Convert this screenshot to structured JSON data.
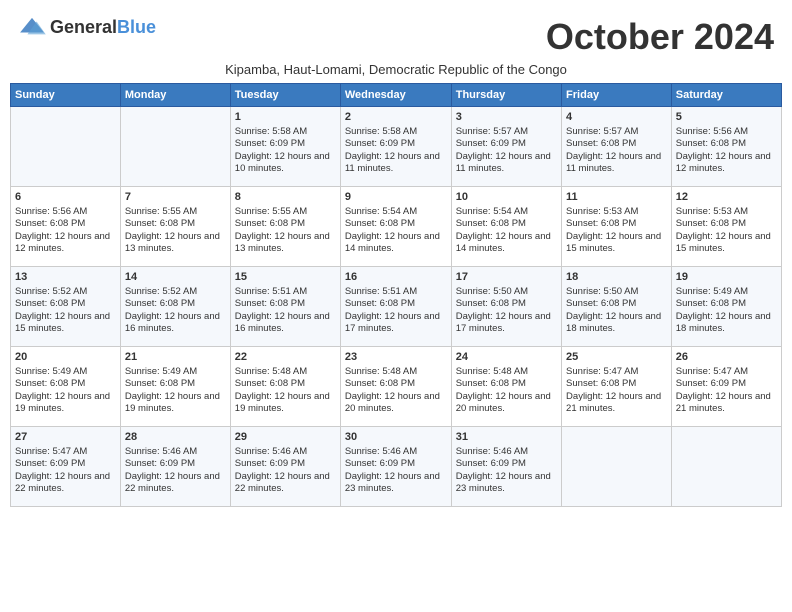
{
  "header": {
    "logo_general": "General",
    "logo_blue": "Blue",
    "month_title": "October 2024",
    "subtitle": "Kipamba, Haut-Lomami, Democratic Republic of the Congo"
  },
  "days_of_week": [
    "Sunday",
    "Monday",
    "Tuesday",
    "Wednesday",
    "Thursday",
    "Friday",
    "Saturday"
  ],
  "weeks": [
    [
      {
        "day": "",
        "sunrise": "",
        "sunset": "",
        "daylight": ""
      },
      {
        "day": "",
        "sunrise": "",
        "sunset": "",
        "daylight": ""
      },
      {
        "day": "1",
        "sunrise": "Sunrise: 5:58 AM",
        "sunset": "Sunset: 6:09 PM",
        "daylight": "Daylight: 12 hours and 10 minutes."
      },
      {
        "day": "2",
        "sunrise": "Sunrise: 5:58 AM",
        "sunset": "Sunset: 6:09 PM",
        "daylight": "Daylight: 12 hours and 11 minutes."
      },
      {
        "day": "3",
        "sunrise": "Sunrise: 5:57 AM",
        "sunset": "Sunset: 6:09 PM",
        "daylight": "Daylight: 12 hours and 11 minutes."
      },
      {
        "day": "4",
        "sunrise": "Sunrise: 5:57 AM",
        "sunset": "Sunset: 6:08 PM",
        "daylight": "Daylight: 12 hours and 11 minutes."
      },
      {
        "day": "5",
        "sunrise": "Sunrise: 5:56 AM",
        "sunset": "Sunset: 6:08 PM",
        "daylight": "Daylight: 12 hours and 12 minutes."
      }
    ],
    [
      {
        "day": "6",
        "sunrise": "Sunrise: 5:56 AM",
        "sunset": "Sunset: 6:08 PM",
        "daylight": "Daylight: 12 hours and 12 minutes."
      },
      {
        "day": "7",
        "sunrise": "Sunrise: 5:55 AM",
        "sunset": "Sunset: 6:08 PM",
        "daylight": "Daylight: 12 hours and 13 minutes."
      },
      {
        "day": "8",
        "sunrise": "Sunrise: 5:55 AM",
        "sunset": "Sunset: 6:08 PM",
        "daylight": "Daylight: 12 hours and 13 minutes."
      },
      {
        "day": "9",
        "sunrise": "Sunrise: 5:54 AM",
        "sunset": "Sunset: 6:08 PM",
        "daylight": "Daylight: 12 hours and 14 minutes."
      },
      {
        "day": "10",
        "sunrise": "Sunrise: 5:54 AM",
        "sunset": "Sunset: 6:08 PM",
        "daylight": "Daylight: 12 hours and 14 minutes."
      },
      {
        "day": "11",
        "sunrise": "Sunrise: 5:53 AM",
        "sunset": "Sunset: 6:08 PM",
        "daylight": "Daylight: 12 hours and 15 minutes."
      },
      {
        "day": "12",
        "sunrise": "Sunrise: 5:53 AM",
        "sunset": "Sunset: 6:08 PM",
        "daylight": "Daylight: 12 hours and 15 minutes."
      }
    ],
    [
      {
        "day": "13",
        "sunrise": "Sunrise: 5:52 AM",
        "sunset": "Sunset: 6:08 PM",
        "daylight": "Daylight: 12 hours and 15 minutes."
      },
      {
        "day": "14",
        "sunrise": "Sunrise: 5:52 AM",
        "sunset": "Sunset: 6:08 PM",
        "daylight": "Daylight: 12 hours and 16 minutes."
      },
      {
        "day": "15",
        "sunrise": "Sunrise: 5:51 AM",
        "sunset": "Sunset: 6:08 PM",
        "daylight": "Daylight: 12 hours and 16 minutes."
      },
      {
        "day": "16",
        "sunrise": "Sunrise: 5:51 AM",
        "sunset": "Sunset: 6:08 PM",
        "daylight": "Daylight: 12 hours and 17 minutes."
      },
      {
        "day": "17",
        "sunrise": "Sunrise: 5:50 AM",
        "sunset": "Sunset: 6:08 PM",
        "daylight": "Daylight: 12 hours and 17 minutes."
      },
      {
        "day": "18",
        "sunrise": "Sunrise: 5:50 AM",
        "sunset": "Sunset: 6:08 PM",
        "daylight": "Daylight: 12 hours and 18 minutes."
      },
      {
        "day": "19",
        "sunrise": "Sunrise: 5:49 AM",
        "sunset": "Sunset: 6:08 PM",
        "daylight": "Daylight: 12 hours and 18 minutes."
      }
    ],
    [
      {
        "day": "20",
        "sunrise": "Sunrise: 5:49 AM",
        "sunset": "Sunset: 6:08 PM",
        "daylight": "Daylight: 12 hours and 19 minutes."
      },
      {
        "day": "21",
        "sunrise": "Sunrise: 5:49 AM",
        "sunset": "Sunset: 6:08 PM",
        "daylight": "Daylight: 12 hours and 19 minutes."
      },
      {
        "day": "22",
        "sunrise": "Sunrise: 5:48 AM",
        "sunset": "Sunset: 6:08 PM",
        "daylight": "Daylight: 12 hours and 19 minutes."
      },
      {
        "day": "23",
        "sunrise": "Sunrise: 5:48 AM",
        "sunset": "Sunset: 6:08 PM",
        "daylight": "Daylight: 12 hours and 20 minutes."
      },
      {
        "day": "24",
        "sunrise": "Sunrise: 5:48 AM",
        "sunset": "Sunset: 6:08 PM",
        "daylight": "Daylight: 12 hours and 20 minutes."
      },
      {
        "day": "25",
        "sunrise": "Sunrise: 5:47 AM",
        "sunset": "Sunset: 6:08 PM",
        "daylight": "Daylight: 12 hours and 21 minutes."
      },
      {
        "day": "26",
        "sunrise": "Sunrise: 5:47 AM",
        "sunset": "Sunset: 6:09 PM",
        "daylight": "Daylight: 12 hours and 21 minutes."
      }
    ],
    [
      {
        "day": "27",
        "sunrise": "Sunrise: 5:47 AM",
        "sunset": "Sunset: 6:09 PM",
        "daylight": "Daylight: 12 hours and 22 minutes."
      },
      {
        "day": "28",
        "sunrise": "Sunrise: 5:46 AM",
        "sunset": "Sunset: 6:09 PM",
        "daylight": "Daylight: 12 hours and 22 minutes."
      },
      {
        "day": "29",
        "sunrise": "Sunrise: 5:46 AM",
        "sunset": "Sunset: 6:09 PM",
        "daylight": "Daylight: 12 hours and 22 minutes."
      },
      {
        "day": "30",
        "sunrise": "Sunrise: 5:46 AM",
        "sunset": "Sunset: 6:09 PM",
        "daylight": "Daylight: 12 hours and 23 minutes."
      },
      {
        "day": "31",
        "sunrise": "Sunrise: 5:46 AM",
        "sunset": "Sunset: 6:09 PM",
        "daylight": "Daylight: 12 hours and 23 minutes."
      },
      {
        "day": "",
        "sunrise": "",
        "sunset": "",
        "daylight": ""
      },
      {
        "day": "",
        "sunrise": "",
        "sunset": "",
        "daylight": ""
      }
    ]
  ]
}
